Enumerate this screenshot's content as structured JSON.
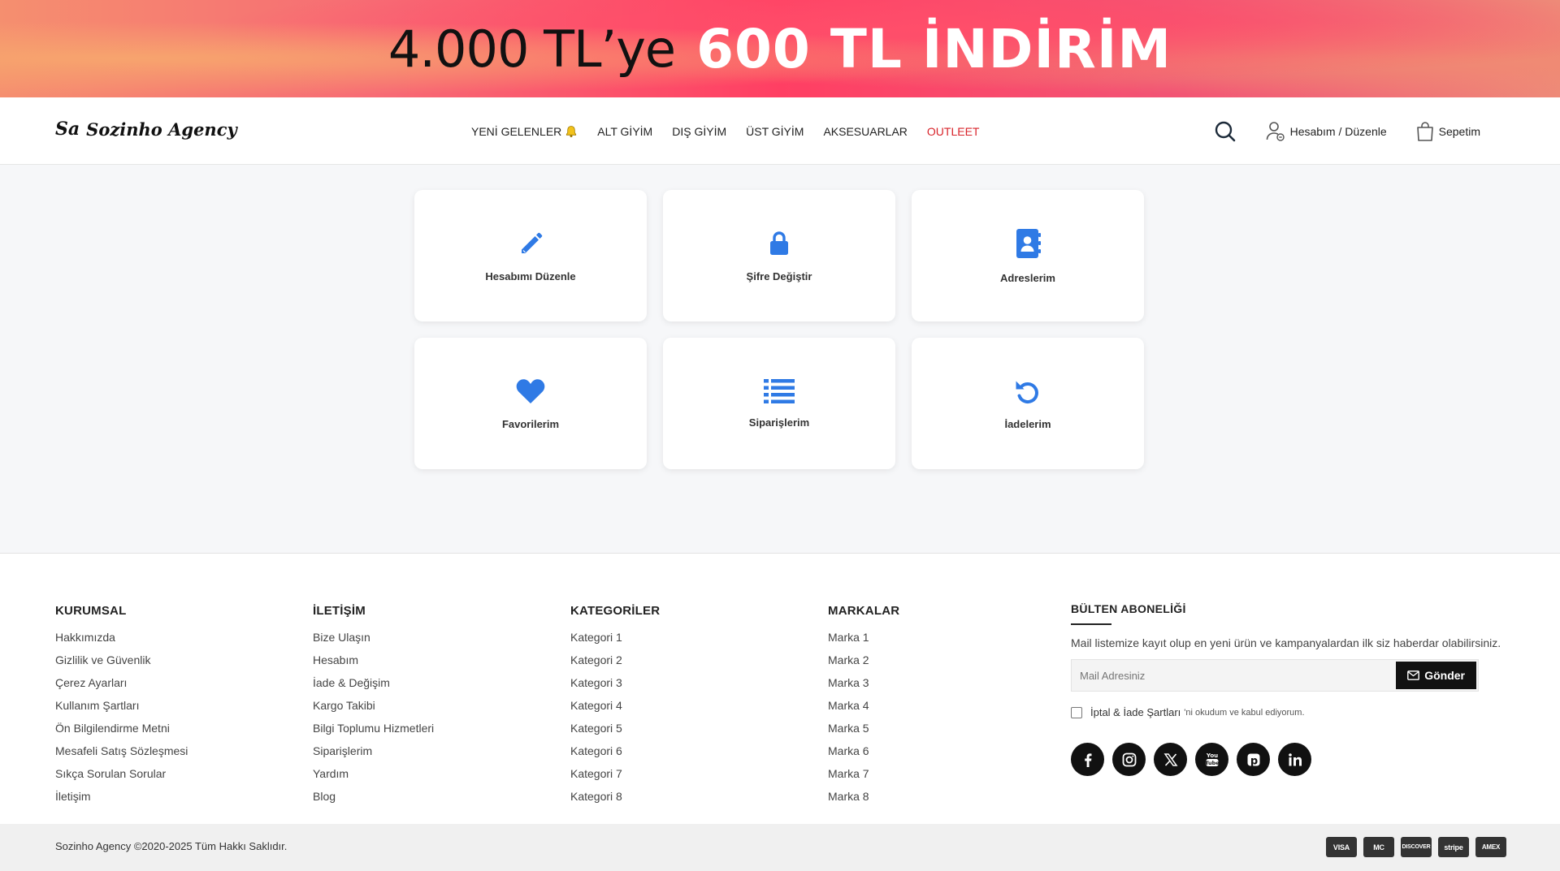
{
  "promo": {
    "dark_text": "4.000 TL’ye",
    "light_text": "600 TL İNDİRİM"
  },
  "header": {
    "logo_mark": "Sa",
    "logo_text": "Sozinho Agency",
    "nav": [
      {
        "label": "YENİ GELENLER",
        "icon": "bell-icon"
      },
      {
        "label": "ALT GİYİM"
      },
      {
        "label": "DIŞ GİYİM"
      },
      {
        "label": "ÜST GİYİM"
      },
      {
        "label": "AKSESUARLAR"
      },
      {
        "label": "OUTLEET",
        "color": "#d8232a"
      }
    ],
    "account_label": "Hesabım / Düzenle",
    "cart_label": "Sepetim"
  },
  "account_cards": [
    {
      "label": "Hesabımı Düzenle",
      "icon": "pencil-icon"
    },
    {
      "label": "Şifre Değiştir",
      "icon": "lock-icon"
    },
    {
      "label": "Adreslerim",
      "icon": "address-book-icon"
    },
    {
      "label": "Favorilerim",
      "icon": "heart-icon"
    },
    {
      "label": "Siparişlerim",
      "icon": "list-icon"
    },
    {
      "label": "İadelerim",
      "icon": "undo-icon"
    }
  ],
  "accent_color": "#2f7ae5",
  "footer": {
    "columns": [
      {
        "title": "KURUMSAL",
        "items": [
          "Hakkımızda",
          "Gizlilik ve Güvenlik",
          "Çerez Ayarları",
          "Kullanım Şartları",
          "Ön Bilgilendirme Metni",
          "Mesafeli Satış Sözleşmesi",
          "Sıkça Sorulan Sorular",
          "İletişim"
        ]
      },
      {
        "title": "İLETİŞİM",
        "items": [
          "Bize Ulaşın",
          "Hesabım",
          "İade & Değişim",
          "Kargo Takibi",
          "Bilgi Toplumu Hizmetleri",
          "Siparişlerim",
          "Yardım",
          "Blog"
        ]
      },
      {
        "title": "KATEGORİLER",
        "items": [
          "Kategori 1",
          "Kategori 2",
          "Kategori 3",
          "Kategori 4",
          "Kategori 5",
          "Kategori 6",
          "Kategori 7",
          "Kategori 8"
        ]
      },
      {
        "title": "MARKALAR",
        "items": [
          "Marka 1",
          "Marka 2",
          "Marka 3",
          "Marka 4",
          "Marka 5",
          "Marka 6",
          "Marka 7",
          "Marka 8"
        ]
      }
    ],
    "newsletter": {
      "title": "BÜLTEN ABONELİĞİ",
      "description": "Mail listemize kayıt olup en yeni ürün ve kampanyalardan ilk siz haberdar olabilirsiniz.",
      "placeholder": "Mail Adresiniz",
      "button": "Gönder",
      "consent_link": "İptal & İade Şartları",
      "consent_suffix": "'ni okudum ve kabul ediyorum."
    },
    "socials": [
      "facebook-icon",
      "instagram-icon",
      "x-icon",
      "youtube-icon",
      "pinterest-icon",
      "linkedin-icon"
    ]
  },
  "bottom": {
    "copyright": "Sozinho Agency ©2020-2025 Tüm Hakkı Saklıdır.",
    "payments": [
      "VISA",
      "MC",
      "DISCOVER",
      "stripe",
      "AMEX"
    ]
  }
}
